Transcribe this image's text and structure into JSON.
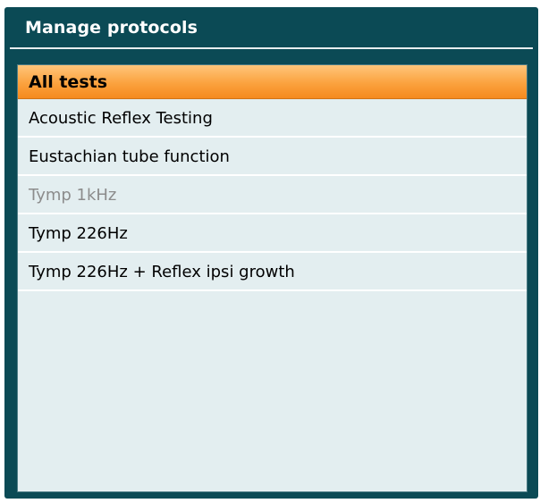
{
  "window": {
    "title": "Manage protocols"
  },
  "list": {
    "header": "All tests",
    "items": [
      {
        "label": "Acoustic Reflex Testing",
        "enabled": true
      },
      {
        "label": "Eustachian tube function",
        "enabled": true
      },
      {
        "label": "Tymp 1kHz",
        "enabled": false
      },
      {
        "label": "Tymp 226Hz",
        "enabled": true
      },
      {
        "label": "Tymp 226Hz + Reflex ipsi growth",
        "enabled": true
      }
    ]
  },
  "colors": {
    "panel_background": "#0b4a55",
    "list_background": "#e3eef0",
    "header_accent": "#fba23e",
    "disabled_text": "#8c8c8c"
  }
}
